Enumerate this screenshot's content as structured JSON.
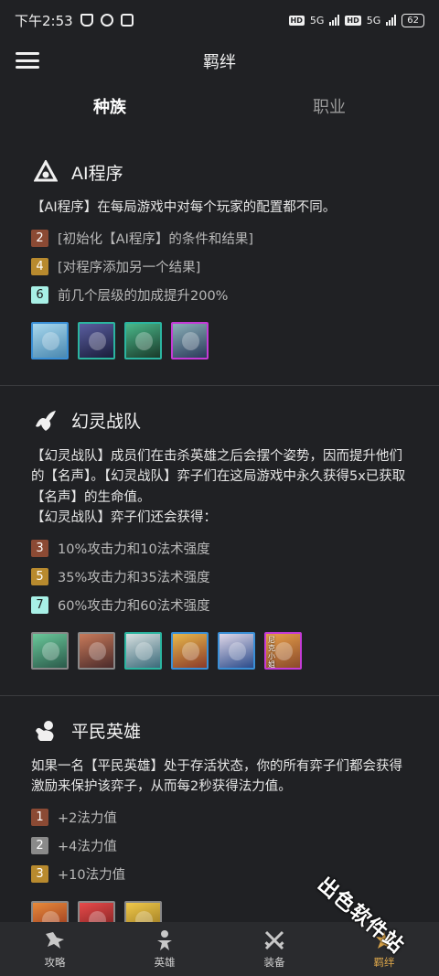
{
  "status": {
    "time": "下午2:53",
    "net1": "5G",
    "net2": "5G",
    "hd1": "HD",
    "hd2": "HD",
    "battery": "62"
  },
  "appbar": {
    "title": "羁绊",
    "menu_icon": "hamburger-menu-icon"
  },
  "tabs": [
    {
      "label": "种族",
      "active": true
    },
    {
      "label": "职业",
      "active": false
    }
  ],
  "sections": [
    {
      "title": "AI程序",
      "icon": "ai-program-icon",
      "description": "【AI程序】在每局游戏中对每个玩家的配置都不同。",
      "tiers": [
        {
          "count": "2",
          "text": "[初始化【AI程序】的条件和结果]",
          "color": "#8b4a34"
        },
        {
          "count": "4",
          "text": "[对程序添加另一个结果]",
          "color": "#b88a2e"
        },
        {
          "count": "6",
          "text": "前几个层级的加成提升200%",
          "color": "#a8f0e6"
        }
      ],
      "units": [
        {
          "border": "#3a8fd6",
          "bg": "#7fb8d8"
        },
        {
          "border": "#2bb5a0",
          "bg": "#3a3e6a"
        },
        {
          "border": "#2bb5a0",
          "bg": "#3a8a6a"
        },
        {
          "border": "#c43bd6",
          "bg": "#4a7a8a"
        }
      ]
    },
    {
      "title": "幻灵战队",
      "icon": "spirit-squad-icon",
      "description": "【幻灵战队】成员们在击杀英雄之后会摆个姿势，因而提升他们的【名声】。【幻灵战队】弈子们在这局游戏中永久获得5x已获取【名声】的生命值。\n【幻灵战队】弈子们还会获得：",
      "tiers": [
        {
          "count": "3",
          "text": "10%攻击力和10法术强度",
          "color": "#8b4a34"
        },
        {
          "count": "5",
          "text": "35%攻击力和35法术强度",
          "color": "#b88a2e"
        },
        {
          "count": "7",
          "text": "60%攻击力和60法术强度",
          "color": "#a8f0e6"
        }
      ],
      "units": [
        {
          "border": "#888888",
          "bg": "#4a9a7a"
        },
        {
          "border": "#888888",
          "bg": "#8a4a3a"
        },
        {
          "border": "#2bb5a0",
          "bg": "#6aa0a0"
        },
        {
          "border": "#3a8fd6",
          "bg": "#b87a3a"
        },
        {
          "border": "#3a8fd6",
          "bg": "#4a6aa0"
        },
        {
          "border": "#c43bd6",
          "bg": "#b8683a"
        }
      ],
      "unit_caption": "尼克小姐"
    },
    {
      "title": "平民英雄",
      "icon": "hero-flex-icon",
      "description": "如果一名【平民英雄】处于存活状态，你的所有弈子们都会获得激励来保护该弈子，从而每2秒获得法力值。",
      "tiers": [
        {
          "count": "1",
          "text": "+2法力值",
          "color": "#8b4a34"
        },
        {
          "count": "2",
          "text": "+4法力值",
          "color": "#8a8a8a"
        },
        {
          "count": "3",
          "text": "+10法力值",
          "color": "#b88a2e"
        }
      ],
      "units": [
        {
          "border": "#888888",
          "bg": "#c86a2a"
        },
        {
          "border": "#888888",
          "bg": "#c83a3a"
        },
        {
          "border": "#888888",
          "bg": "#d8a83a"
        }
      ]
    }
  ],
  "bottom_nav": [
    {
      "label": "攻略",
      "icon": "guide-icon",
      "active": false
    },
    {
      "label": "英雄",
      "icon": "champion-icon",
      "active": false
    },
    {
      "label": "装备",
      "icon": "items-swords-icon",
      "active": false
    },
    {
      "label": "羁绊",
      "icon": "synergy-icon",
      "active": true
    }
  ],
  "watermark": "出色软件站"
}
